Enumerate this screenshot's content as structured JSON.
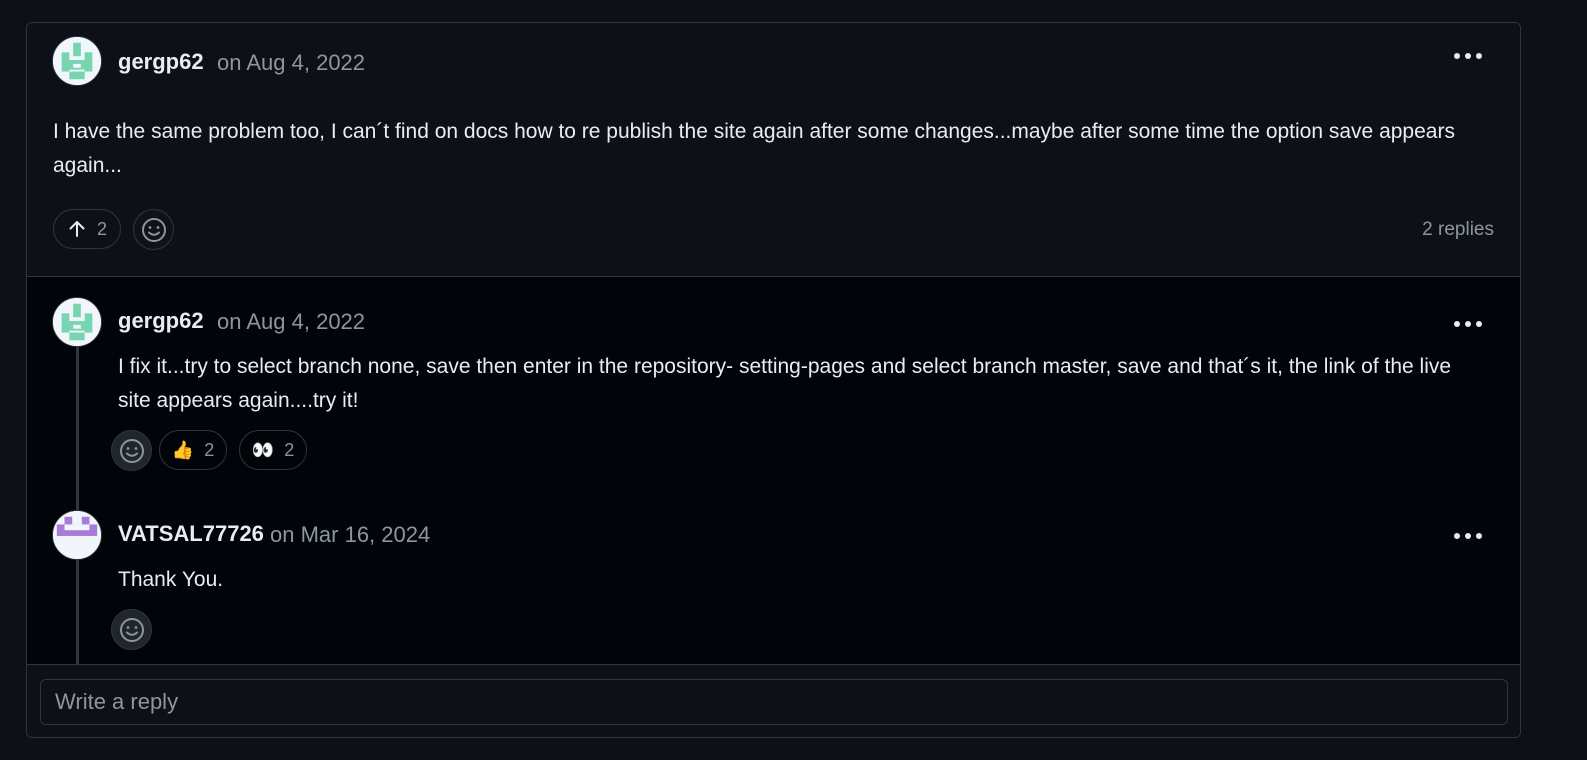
{
  "comment": {
    "author": "gergp62",
    "date": "on Aug 4, 2022",
    "body": "I have the same problem too, I can´t find on docs how to re publish the site again after some changes...maybe after some time the option save appears again...",
    "upvote_icon": "arrow-up-icon",
    "upvotes": "2",
    "reaction_icon": "smiley-icon",
    "replies_label": "2 replies",
    "avatar_color": "#79d4b0"
  },
  "replies": [
    {
      "author": "gergp62",
      "date": "on Aug 4, 2022",
      "body": "I fix it...try to select branch none, save then enter in the repository- setting-pages and select branch master, save and that´s it, the link of the live site appears again....try it!",
      "reactions": [
        {
          "emoji": "👍",
          "name": "thumbs-up-icon",
          "count": "2"
        },
        {
          "emoji": "👀",
          "name": "eyes-icon",
          "count": "2"
        }
      ],
      "avatar_color": "#79d4b0"
    },
    {
      "author": "VATSAL77726",
      "date": "on Mar 16, 2024",
      "body": "Thank You.",
      "reactions": [],
      "avatar_color": "#a77bd8"
    }
  ],
  "composer": {
    "placeholder": "Write a reply"
  }
}
